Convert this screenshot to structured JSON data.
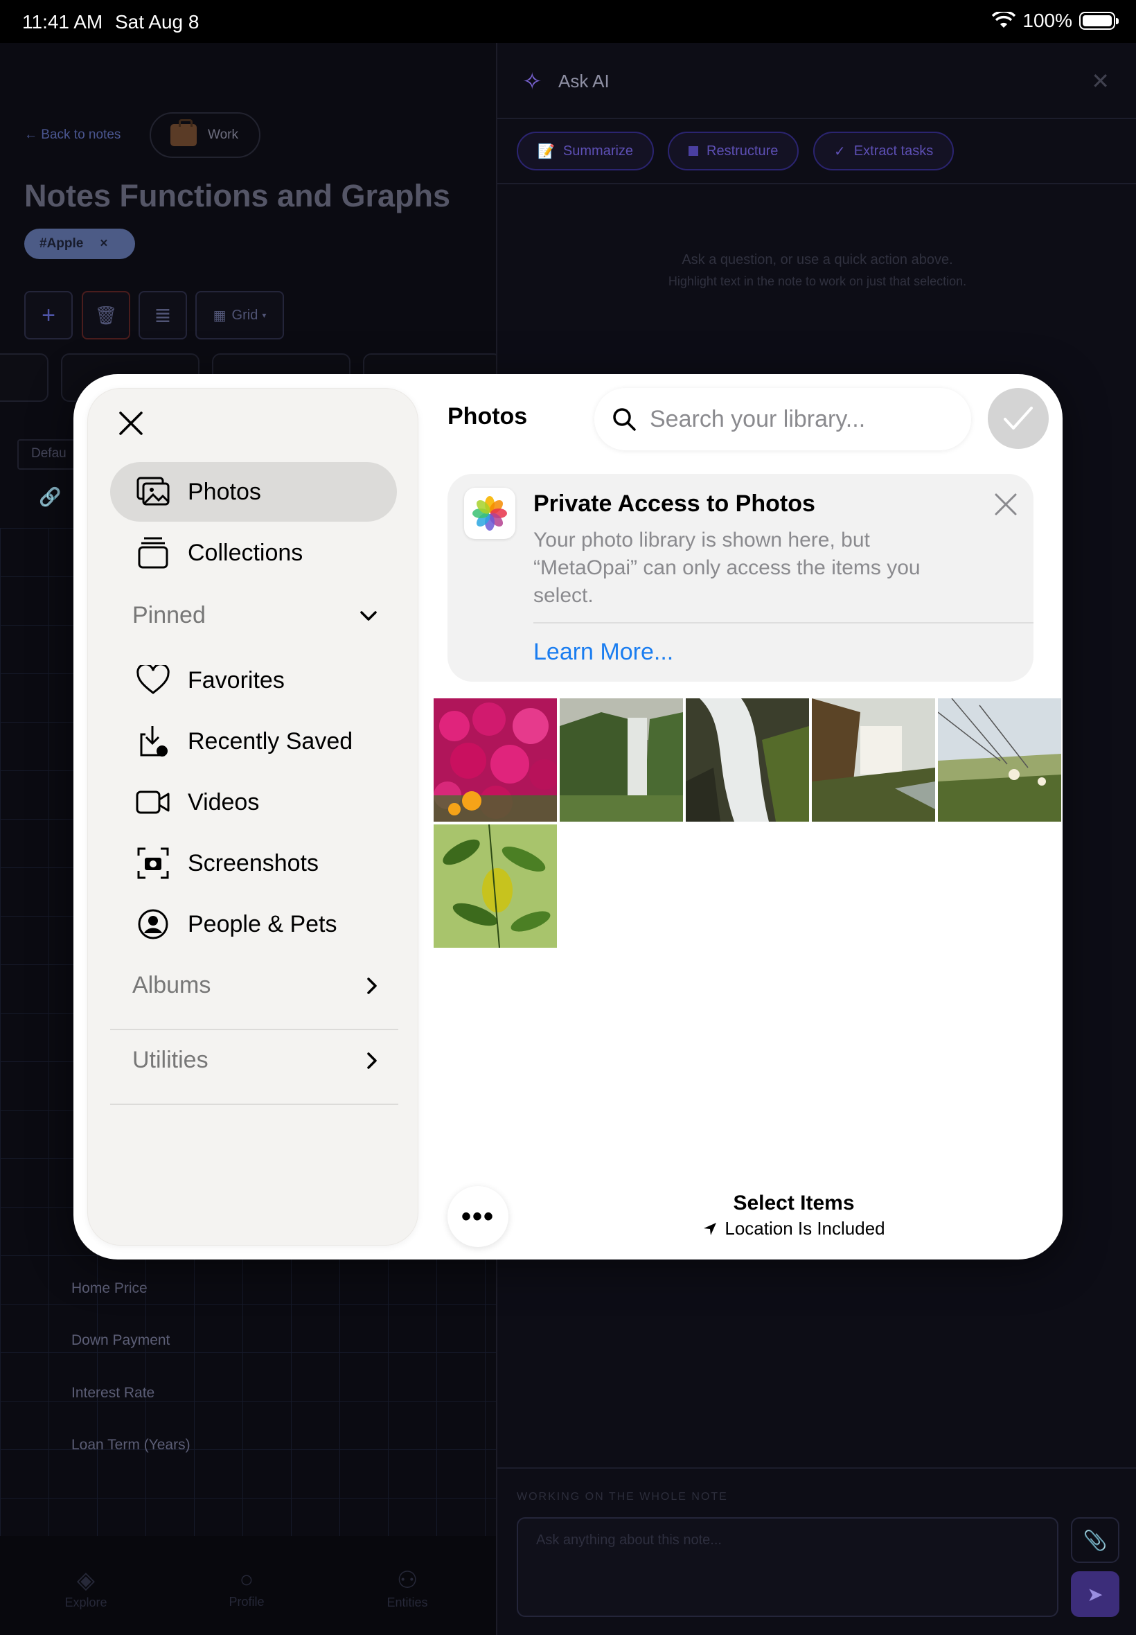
{
  "status_bar": {
    "time": "11:41 AM",
    "date": "Sat Aug 8",
    "battery": "100%"
  },
  "note": {
    "back_label": "← Back to notes",
    "category": "Work",
    "title": "Notes Functions and Graphs",
    "tag": "#Apple",
    "view_label": "Grid",
    "side_label": "Defau",
    "fields": [
      "Home Price",
      "Down Payment",
      "Interest Rate",
      "Loan Term (Years)"
    ]
  },
  "bottom_tabs": [
    "Explore",
    "Profile",
    "Entities"
  ],
  "ask_ai": {
    "title": "Ask AI",
    "actions": [
      {
        "icon": "memo-icon",
        "label": "Summarize"
      },
      {
        "icon": "square-icon",
        "label": "Restructure"
      },
      {
        "icon": "check-icon",
        "label": "Extract tasks"
      }
    ],
    "hint_line1": "Ask a question, or use a quick action above.",
    "hint_line2": "Highlight text in the note to work on just that selection.",
    "working_label": "WORKING ON THE WHOLE NOTE",
    "input_placeholder": "Ask anything about this note..."
  },
  "picker": {
    "title": "Photos",
    "search_placeholder": "Search your library...",
    "sidebar": {
      "top_items": [
        {
          "icon": "photos-icon",
          "label": "Photos",
          "selected": true
        },
        {
          "icon": "collections-icon",
          "label": "Collections"
        }
      ],
      "pinned_label": "Pinned",
      "pinned_items": [
        {
          "icon": "heart-icon",
          "label": "Favorites"
        },
        {
          "icon": "download-icon",
          "label": "Recently Saved"
        },
        {
          "icon": "video-icon",
          "label": "Videos"
        },
        {
          "icon": "screenshot-icon",
          "label": "Screenshots"
        },
        {
          "icon": "person-icon",
          "label": "People & Pets"
        }
      ],
      "albums_label": "Albums",
      "utilities_label": "Utilities"
    },
    "banner": {
      "title": "Private Access to Photos",
      "body": "Your photo library is shown here, but “MetaOpai” can only access the items you select.",
      "link": "Learn More..."
    },
    "photos": [
      {
        "subject": "pink flowers"
      },
      {
        "subject": "waterfall cliff"
      },
      {
        "subject": "long exposure waterfall"
      },
      {
        "subject": "waterfall sunset"
      },
      {
        "subject": "coastal plants"
      },
      {
        "subject": "lemon tree"
      }
    ],
    "footer_title": "Select Items",
    "footer_subtitle": "Location Is Included"
  },
  "colors": {
    "link_blue": "#1a7df0",
    "accent_purple": "#7b64d6",
    "sheet_bg": "#ffffff"
  }
}
